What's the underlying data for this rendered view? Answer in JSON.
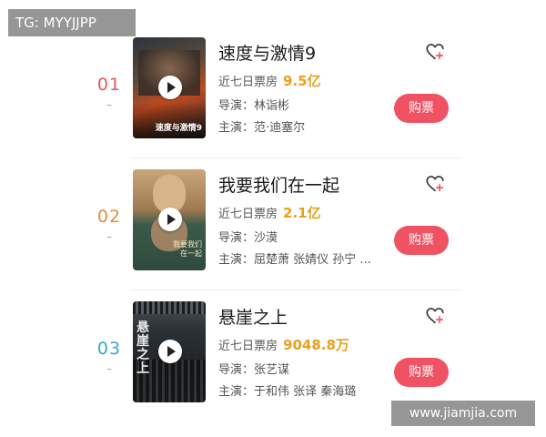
{
  "watermarks": {
    "top_left": "TG: MYYJJPP",
    "bottom_right": "www.jiamjia.com"
  },
  "box_office_label": "近七日票房",
  "director_prefix": "导演：",
  "cast_prefix": "主演：",
  "buy_label": "购票",
  "movies": [
    {
      "rank": "01",
      "rank_color": "#e35a5a",
      "dash": "–",
      "title": "速度与激情9",
      "gross": "9.5亿",
      "director": "林诣彬",
      "cast": "范·迪塞尔",
      "poster_caption": "速度与激情9"
    },
    {
      "rank": "02",
      "rank_color": "#e38a3a",
      "dash": "–",
      "title": "我要我们在一起",
      "gross": "2.1亿",
      "director": "沙漠",
      "cast": "屈楚萧 张婧仪 孙宁 ...",
      "poster_caption": "我要我们在一起"
    },
    {
      "rank": "03",
      "rank_color": "#37a9c8",
      "dash": "–",
      "title": "悬崖之上",
      "gross": "9048.8万",
      "director": "张艺谋",
      "cast": "于和伟 张译 秦海璐",
      "poster_caption": "悬崖之上"
    }
  ],
  "colors": {
    "buy_button": "#ef5263",
    "gross": "#e8a020"
  },
  "icons": {
    "favorite": "heart-plus-icon",
    "play": "play-icon"
  }
}
